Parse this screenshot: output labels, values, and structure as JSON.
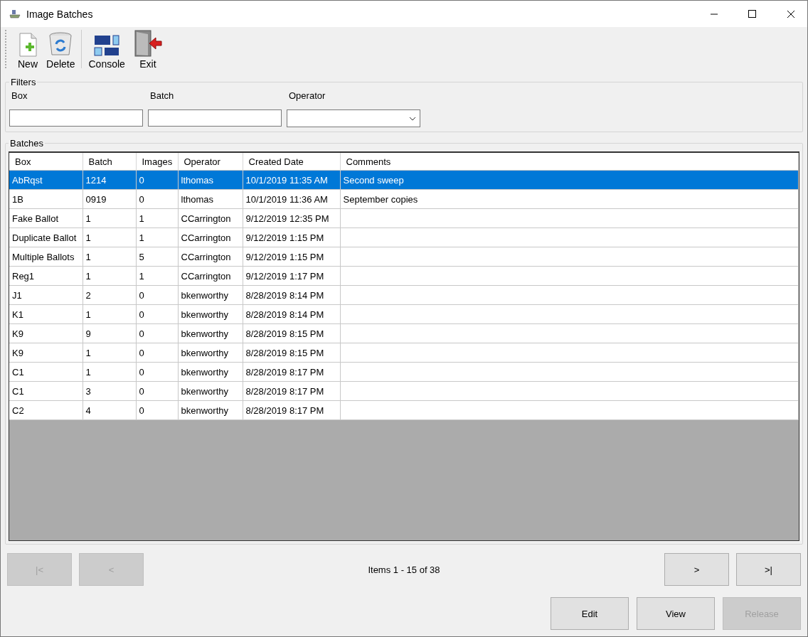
{
  "window": {
    "title": "Image Batches"
  },
  "toolbar": [
    {
      "kind": "new",
      "label": "New"
    },
    {
      "kind": "delete",
      "label": "Delete"
    },
    {
      "kind": "console",
      "label": "Console"
    },
    {
      "kind": "exit",
      "label": "Exit"
    }
  ],
  "filters": {
    "title": "Filters",
    "fields": [
      {
        "kind": "text",
        "label": "Box"
      },
      {
        "kind": "text",
        "label": "Batch"
      },
      {
        "kind": "dropdown",
        "label": "Operator"
      }
    ]
  },
  "batches": {
    "title": "Batches",
    "columns": [
      "Box",
      "Batch",
      "Images",
      "Operator",
      "Created Date",
      "Comments"
    ],
    "rows": [
      {
        "selected": true,
        "cells": [
          "AbRqst",
          "1214",
          "0",
          "lthomas",
          "10/1/2019 11:35 AM",
          "Second sweep"
        ]
      },
      {
        "selected": false,
        "cells": [
          "1B",
          "0919",
          "0",
          "lthomas",
          "10/1/2019 11:36 AM",
          "September copies"
        ]
      },
      {
        "selected": false,
        "cells": [
          "Fake Ballot",
          "1",
          "1",
          "CCarrington",
          "9/12/2019 12:35 PM",
          ""
        ]
      },
      {
        "selected": false,
        "cells": [
          "Duplicate Ballot",
          "1",
          "1",
          "CCarrington",
          "9/12/2019 1:15 PM",
          ""
        ]
      },
      {
        "selected": false,
        "cells": [
          "Multiple Ballots",
          "1",
          "5",
          "CCarrington",
          "9/12/2019 1:15 PM",
          ""
        ]
      },
      {
        "selected": false,
        "cells": [
          "Reg1",
          "1",
          "1",
          "CCarrington",
          "9/12/2019 1:17 PM",
          ""
        ]
      },
      {
        "selected": false,
        "cells": [
          "J1",
          "2",
          "0",
          "bkenworthy",
          "8/28/2019 8:14 PM",
          ""
        ]
      },
      {
        "selected": false,
        "cells": [
          "K1",
          "1",
          "0",
          "bkenworthy",
          "8/28/2019 8:14 PM",
          ""
        ]
      },
      {
        "selected": false,
        "cells": [
          "K9",
          "9",
          "0",
          "bkenworthy",
          "8/28/2019 8:15 PM",
          ""
        ]
      },
      {
        "selected": false,
        "cells": [
          "K9",
          "1",
          "0",
          "bkenworthy",
          "8/28/2019 8:15 PM",
          ""
        ]
      },
      {
        "selected": false,
        "cells": [
          "C1",
          "1",
          "0",
          "bkenworthy",
          "8/28/2019 8:17 PM",
          ""
        ]
      },
      {
        "selected": false,
        "cells": [
          "C1",
          "3",
          "0",
          "bkenworthy",
          "8/28/2019 8:17 PM",
          ""
        ]
      },
      {
        "selected": false,
        "cells": [
          "C2",
          "4",
          "0",
          "bkenworthy",
          "8/28/2019 8:17 PM",
          ""
        ]
      }
    ]
  },
  "pager": {
    "left": [
      {
        "label": "|<",
        "disabled": true
      },
      {
        "label": "<",
        "disabled": true
      }
    ],
    "status": "Items 1 - 15 of 38",
    "right": [
      {
        "label": ">",
        "disabled": false
      },
      {
        "label": ">|",
        "disabled": false
      }
    ]
  },
  "actions": [
    {
      "label": "Edit",
      "disabled": false
    },
    {
      "label": "View",
      "disabled": false
    },
    {
      "label": "Release",
      "disabled": true
    }
  ]
}
